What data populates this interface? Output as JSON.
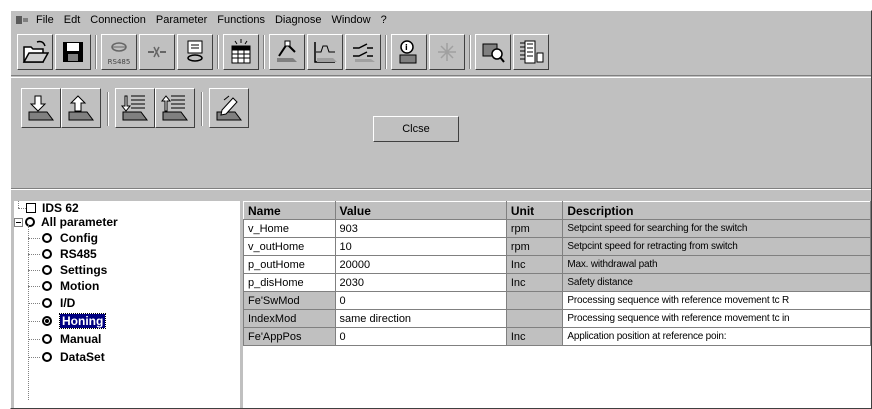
{
  "menu": {
    "items": [
      "File",
      "Edt",
      "Connection",
      "Parameter",
      "Functions",
      "Diagnose",
      "Window",
      "?"
    ]
  },
  "toolbar": {
    "rs485_label": "RS485"
  },
  "action_bar": {
    "close_label": "Clcse"
  },
  "tree": {
    "root": "IDS 62",
    "group": "All parameter",
    "items": [
      "Config",
      "RS485",
      "Settings",
      "Motion",
      "I/D",
      "Honing",
      "Manual",
      "DataSet"
    ],
    "selected": "Honing"
  },
  "table": {
    "headers": [
      "Name",
      "Value",
      "Unit",
      "Description"
    ],
    "rows": [
      {
        "name": "v_Home",
        "value": "903",
        "unit": "rpm",
        "description": "Setpcint speed for searching for the switch",
        "editable": true
      },
      {
        "name": "v_outHome",
        "value": "10",
        "unit": "rpm",
        "description": "Setpcint speed for retracting from switch",
        "editable": true
      },
      {
        "name": "p_outHome",
        "value": "20000",
        "unit": "Inc",
        "description": "Max. withdrawal path",
        "editable": true
      },
      {
        "name": "p_disHome",
        "value": "2030",
        "unit": "Inc",
        "description": "Safety distance",
        "editable": true
      },
      {
        "name": "Fe'SwMod",
        "value": "0",
        "unit": "",
        "description": "Processing sequence with reference movement tc R",
        "editable": false
      },
      {
        "name": "IndexMod",
        "value": "same direction",
        "unit": "",
        "description": "Processing sequence with reference movement tc in",
        "editable": false
      },
      {
        "name": "Fe'AppPos",
        "value": "0",
        "unit": "Inc",
        "description": "Application position at reference poin:",
        "editable": false
      }
    ]
  },
  "colors": {
    "window_bg": "#c0c0c0",
    "selection": "#000080"
  }
}
